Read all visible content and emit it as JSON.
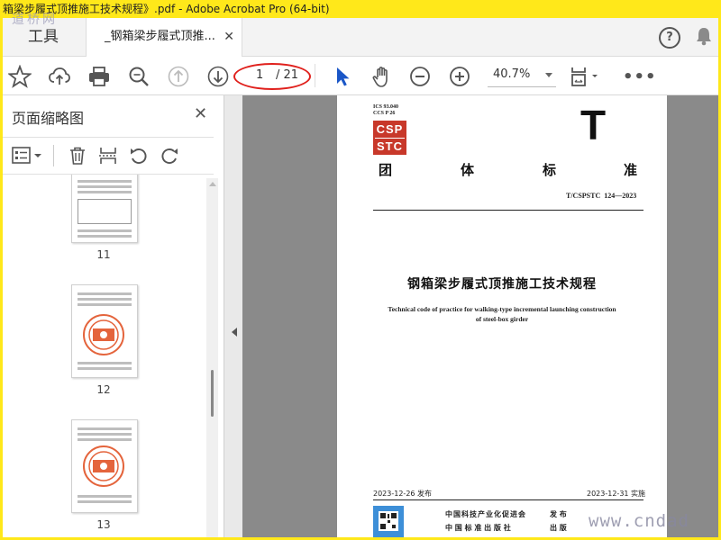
{
  "window": {
    "title": "箱梁步履式顶推施工技术规程》.pdf - Adobe Acrobat Pro (64-bit)"
  },
  "watermarks": {
    "top": "道桥网",
    "bottom": "www.cndad"
  },
  "tabs": {
    "tools": "工具",
    "document": "_钢箱梁步履式顶推..."
  },
  "toolbar": {
    "page_current": "1",
    "page_total": "/ 21",
    "zoom": "40.7%"
  },
  "sidebar": {
    "title": "页面缩略图",
    "thumbnails": [
      {
        "label": "11"
      },
      {
        "label": "12"
      },
      {
        "label": "13"
      }
    ]
  },
  "document": {
    "ics": "ICS 93.040",
    "ccs": "CCS P 26",
    "logo_top": "CSP",
    "logo_bottom": "STC",
    "big_letter": "T",
    "standard_type": [
      "团",
      "体",
      "标",
      "准"
    ],
    "code": "T/CSPSTC  124—2023",
    "title_cn": "钢箱梁步履式顶推施工技术规程",
    "title_en_1": "Technical code of practice for walking-type incremental launching construction",
    "title_en_2": "of steel-box girder",
    "publish_date": "2023-12-26 发布",
    "effective_date": "2023-12-31 实施",
    "publisher_1": "中国科技产业化促进会",
    "publisher_1_action": "发 布",
    "publisher_2": "中 国 标 准 出 版 社",
    "publisher_2_action": "出 版"
  },
  "colors": {
    "accent_red": "#e0201c",
    "brand_red": "#c8382a",
    "cursor_blue": "#1a56c7",
    "title_yellow": "#ffe81a"
  }
}
